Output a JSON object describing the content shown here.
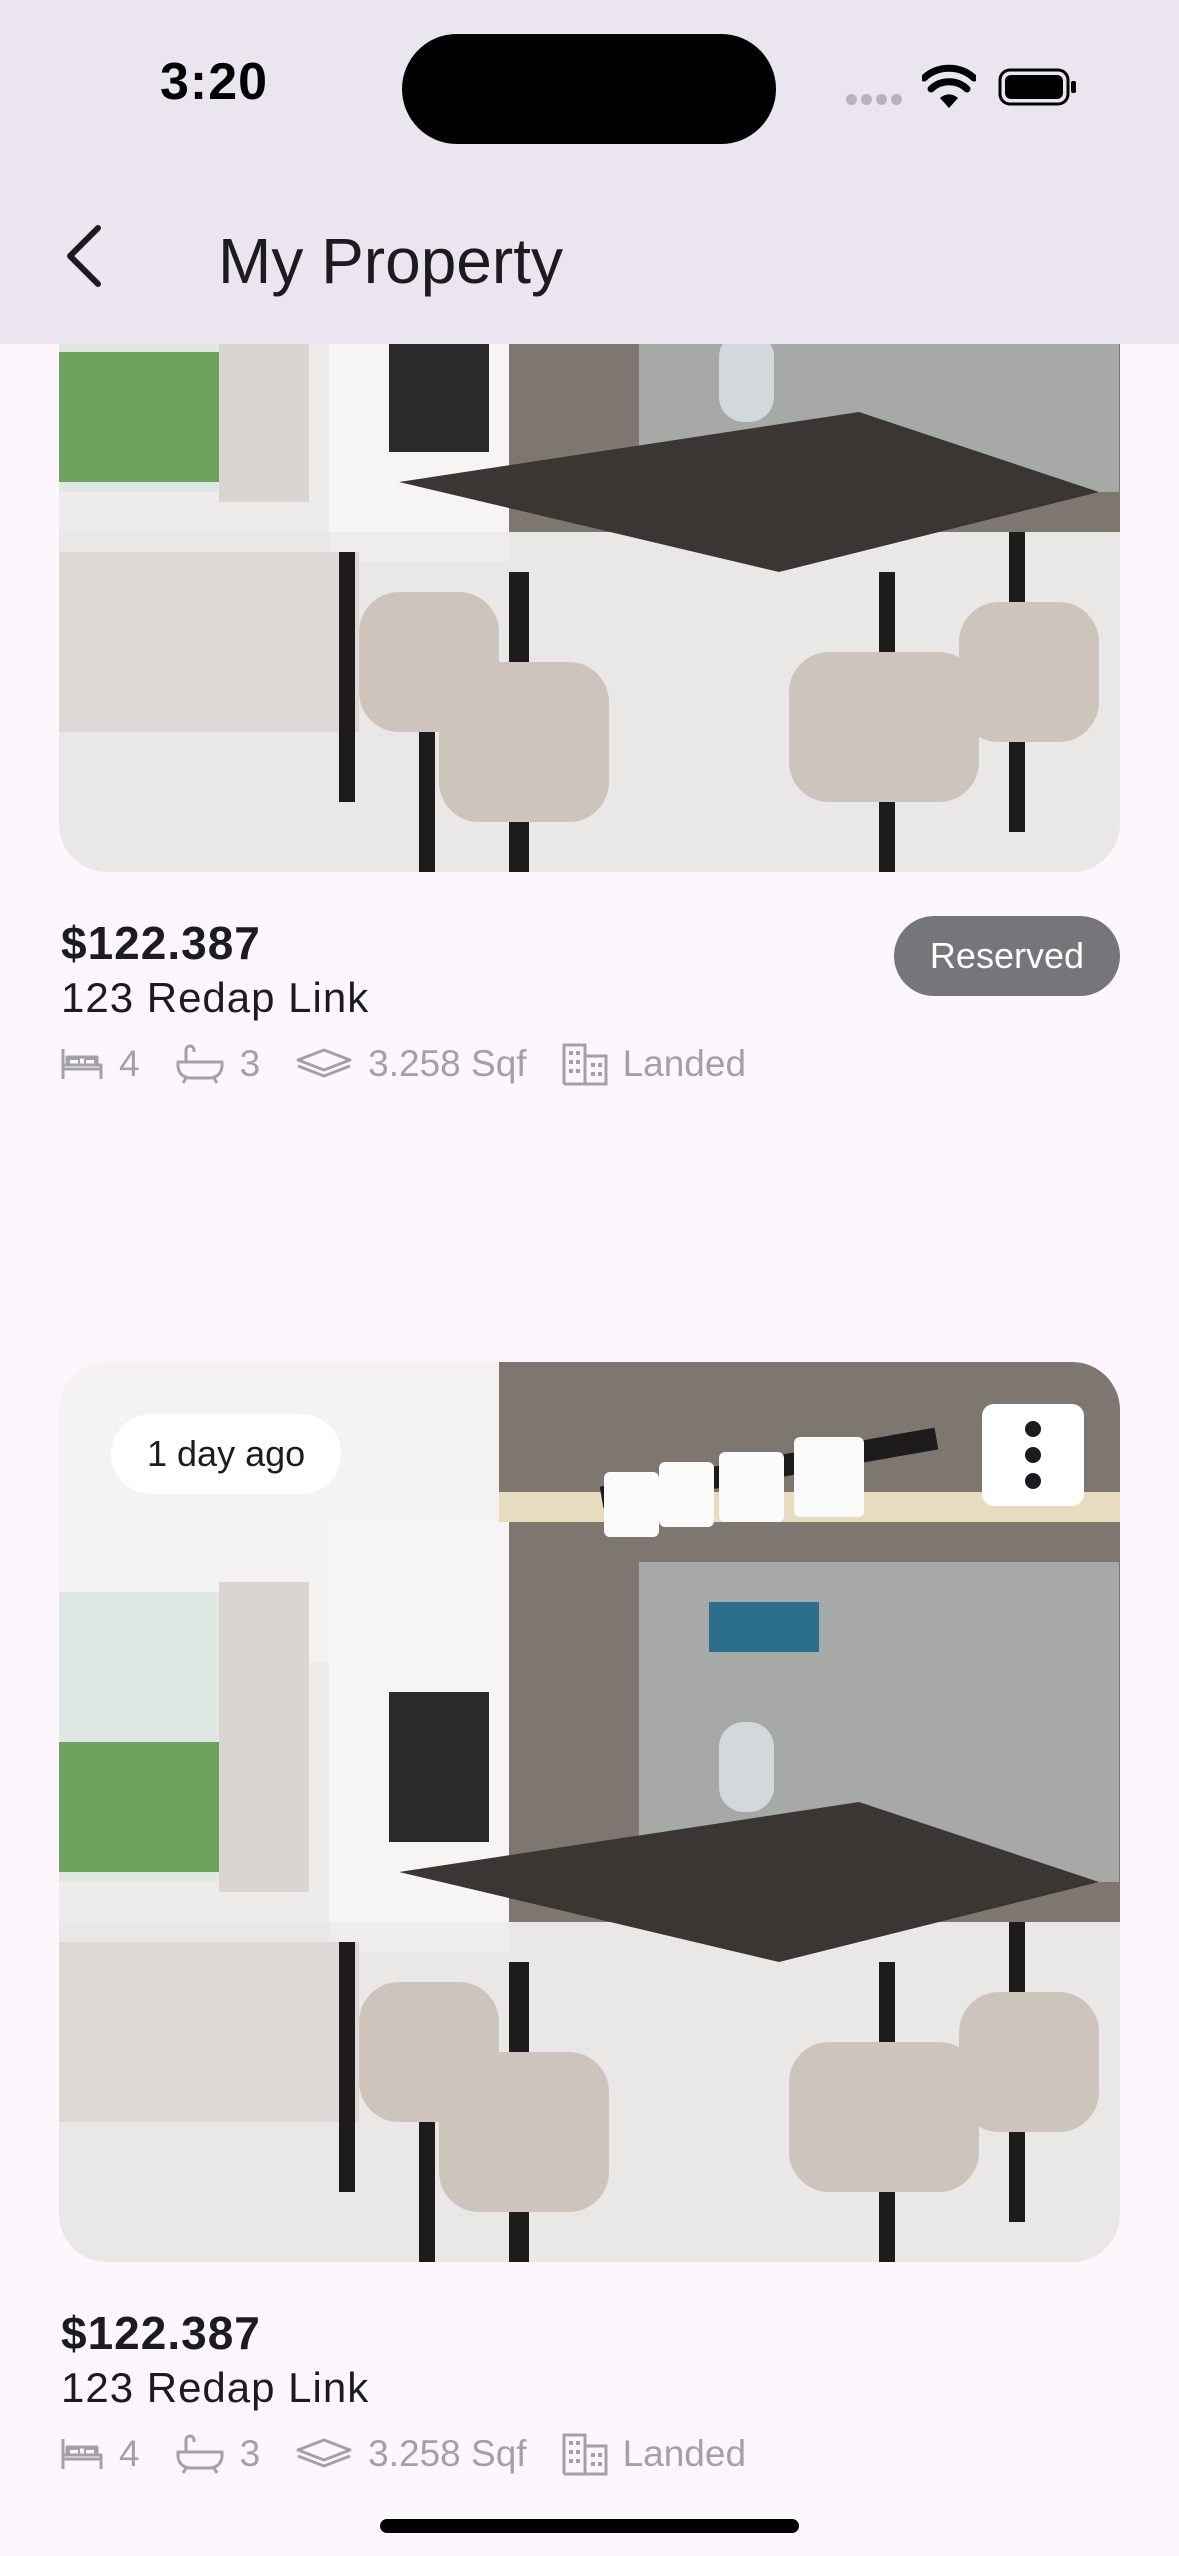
{
  "status_bar": {
    "time": "3:20"
  },
  "app_bar": {
    "title": "My Property"
  },
  "properties": [
    {
      "price": "$122.387",
      "address": "123 Redap Link",
      "bedrooms": "4",
      "bathrooms": "3",
      "area": "3.258 Sqf",
      "type": "Landed",
      "status": "Reserved"
    },
    {
      "posted": "1 day ago",
      "price": "$122.387",
      "address": "123 Redap Link",
      "bedrooms": "4",
      "bathrooms": "3",
      "area": "3.258 Sqf",
      "type": "Landed"
    }
  ],
  "colors": {
    "background": "#fdf7fd",
    "app_bar": "#ebe5ef",
    "badge": "#76767a",
    "muted_text": "#a3a1a8"
  }
}
